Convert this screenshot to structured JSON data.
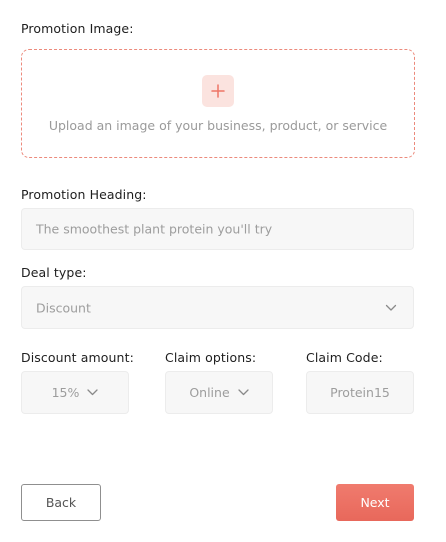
{
  "form": {
    "image_label": "Promotion Image:",
    "upload_text": "Upload an image of your business, product, or service",
    "heading_label": "Promotion Heading:",
    "heading_placeholder": "The smoothest plant protein you'll try",
    "deal_label": "Deal type:",
    "deal_value": "Discount",
    "amount_label": "Discount amount:",
    "amount_value": "15%",
    "claim_label": "Claim options:",
    "claim_value": "Online",
    "code_label": "Claim Code:",
    "code_value": "Protein15"
  },
  "buttons": {
    "back_label": "Back",
    "next_label": "Next"
  },
  "colors": {
    "accent": "#ee7466",
    "dashed_border": "#ec8a7c",
    "plus_bg": "#fbe3df"
  },
  "icons": {
    "upload": "plus-icon",
    "dropdown": "chevron-down-icon"
  }
}
